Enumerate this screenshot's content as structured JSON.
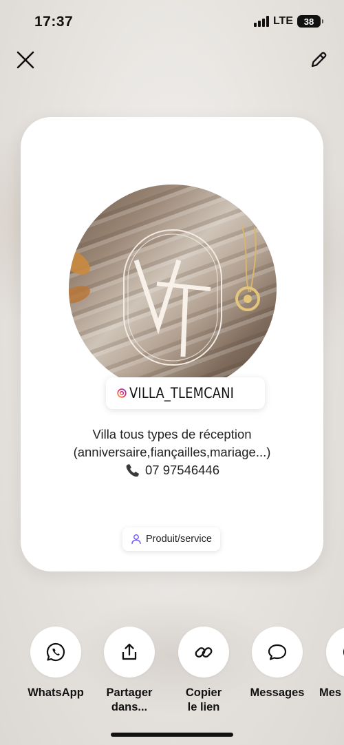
{
  "status_bar": {
    "time": "17:37",
    "network": "LTE",
    "battery": "38"
  },
  "header": {
    "close_icon": "close-icon",
    "edit_icon": "pencil-icon"
  },
  "card": {
    "avatar_monogram": "VT",
    "handle": "VILLA_TLEMCANI",
    "bio_line1": "Villa tous types de réception",
    "bio_line2": "(anniversaire,fiançailles,mariage...)",
    "bio_phone": "07 97546446",
    "category": "Produit/service"
  },
  "share_options": [
    {
      "label": "WhatsApp",
      "icon": "whatsapp-icon"
    },
    {
      "label": "Partager dans...",
      "icon": "share-icon"
    },
    {
      "label": "Copier le lien",
      "icon": "link-icon"
    },
    {
      "label": "Messages",
      "icon": "message-icon"
    },
    {
      "label": "Mes",
      "icon": "messenger-icon"
    }
  ],
  "colors": {
    "card_bg": "#ffffff",
    "text": "#111111",
    "category_icon": "#7b5cf0"
  }
}
